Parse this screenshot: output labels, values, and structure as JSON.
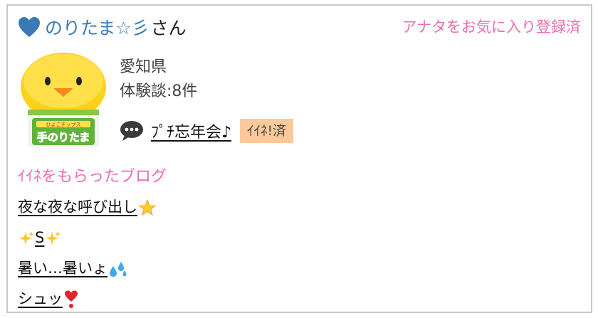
{
  "header": {
    "user_name": "のりたま☆彡",
    "honorific": "さん",
    "favorite_status": "アナタをお気に入り登録済"
  },
  "profile": {
    "prefecture": "愛知県",
    "reviews": "体験談:8件",
    "avatar_label": "手のりたま",
    "avatar_small_text": "ひよこチップス"
  },
  "latest_post": {
    "title": "ﾌﾟﾁ忘年会♪",
    "ine_badge": "ｲｲﾈ!済"
  },
  "liked_blogs": {
    "heading": "ｲｲﾈをもらったブログ",
    "items": [
      {
        "text": "夜な夜な呼び出し",
        "emoji": "star"
      },
      {
        "text": "S",
        "emoji": "sparkles"
      },
      {
        "text": "暑い…暑いょ",
        "emoji": "sweat-drops"
      },
      {
        "text": "シュッ",
        "emoji": "exclamation-heart"
      }
    ]
  },
  "colors": {
    "name_blue": "#3b78b6",
    "pink_accent": "#e86fb3",
    "badge_bg": "#fbc99a",
    "border": "#c9c9c9"
  }
}
